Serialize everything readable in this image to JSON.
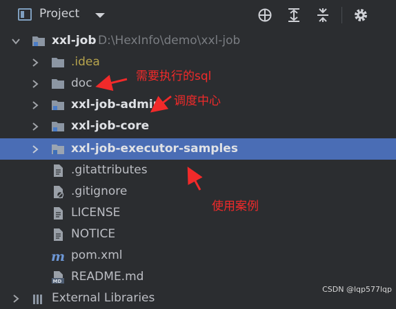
{
  "toolbar": {
    "title": "Project",
    "icons": [
      "project-view-icon",
      "dropdown-arrow-icon",
      "locate-icon",
      "expand-all-icon",
      "collapse-all-icon",
      "settings-icon"
    ]
  },
  "tree": {
    "root": {
      "name": "xxl-job",
      "path": "D:\\HexInfo\\demo\\xxl-job",
      "expanded": true
    },
    "items": [
      {
        "label": ".idea",
        "type": "folder",
        "expanded": false
      },
      {
        "label": "doc",
        "type": "folder",
        "expanded": false
      },
      {
        "label": "xxl-job-admin",
        "type": "module",
        "expanded": false
      },
      {
        "label": "xxl-job-core",
        "type": "module",
        "expanded": false
      },
      {
        "label": "xxl-job-executor-samples",
        "type": "module",
        "expanded": false,
        "selected": true
      },
      {
        "label": ".gitattributes",
        "type": "file"
      },
      {
        "label": ".gitignore",
        "type": "file-ignored"
      },
      {
        "label": "LICENSE",
        "type": "file"
      },
      {
        "label": "NOTICE",
        "type": "file"
      },
      {
        "label": "pom.xml",
        "type": "maven"
      },
      {
        "label": "README.md",
        "type": "markdown"
      }
    ],
    "external_libraries": "External Libraries"
  },
  "annotations": {
    "sql": "需要执行的sql",
    "admin": "调度中心",
    "samples": "使用案例"
  },
  "watermark": "CSDN @lqp577lqp",
  "colors": {
    "background": "#2b2d30",
    "selection": "#4a6db5",
    "annotation": "#f12a2a"
  }
}
